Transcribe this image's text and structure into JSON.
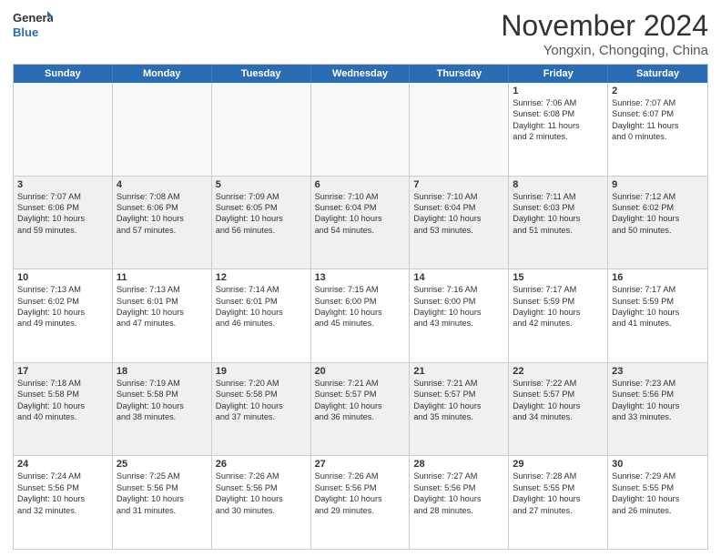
{
  "logo": {
    "general": "General",
    "blue": "Blue"
  },
  "title": "November 2024",
  "subtitle": "Yongxin, Chongqing, China",
  "headers": [
    "Sunday",
    "Monday",
    "Tuesday",
    "Wednesday",
    "Thursday",
    "Friday",
    "Saturday"
  ],
  "rows": [
    [
      {
        "day": "",
        "text": "",
        "empty": true
      },
      {
        "day": "",
        "text": "",
        "empty": true
      },
      {
        "day": "",
        "text": "",
        "empty": true
      },
      {
        "day": "",
        "text": "",
        "empty": true
      },
      {
        "day": "",
        "text": "",
        "empty": true
      },
      {
        "day": "1",
        "text": "Sunrise: 7:06 AM\nSunset: 6:08 PM\nDaylight: 11 hours\nand 2 minutes.",
        "empty": false
      },
      {
        "day": "2",
        "text": "Sunrise: 7:07 AM\nSunset: 6:07 PM\nDaylight: 11 hours\nand 0 minutes.",
        "empty": false
      }
    ],
    [
      {
        "day": "3",
        "text": "Sunrise: 7:07 AM\nSunset: 6:06 PM\nDaylight: 10 hours\nand 59 minutes.",
        "empty": false
      },
      {
        "day": "4",
        "text": "Sunrise: 7:08 AM\nSunset: 6:06 PM\nDaylight: 10 hours\nand 57 minutes.",
        "empty": false
      },
      {
        "day": "5",
        "text": "Sunrise: 7:09 AM\nSunset: 6:05 PM\nDaylight: 10 hours\nand 56 minutes.",
        "empty": false
      },
      {
        "day": "6",
        "text": "Sunrise: 7:10 AM\nSunset: 6:04 PM\nDaylight: 10 hours\nand 54 minutes.",
        "empty": false
      },
      {
        "day": "7",
        "text": "Sunrise: 7:10 AM\nSunset: 6:04 PM\nDaylight: 10 hours\nand 53 minutes.",
        "empty": false
      },
      {
        "day": "8",
        "text": "Sunrise: 7:11 AM\nSunset: 6:03 PM\nDaylight: 10 hours\nand 51 minutes.",
        "empty": false
      },
      {
        "day": "9",
        "text": "Sunrise: 7:12 AM\nSunset: 6:02 PM\nDaylight: 10 hours\nand 50 minutes.",
        "empty": false
      }
    ],
    [
      {
        "day": "10",
        "text": "Sunrise: 7:13 AM\nSunset: 6:02 PM\nDaylight: 10 hours\nand 49 minutes.",
        "empty": false
      },
      {
        "day": "11",
        "text": "Sunrise: 7:13 AM\nSunset: 6:01 PM\nDaylight: 10 hours\nand 47 minutes.",
        "empty": false
      },
      {
        "day": "12",
        "text": "Sunrise: 7:14 AM\nSunset: 6:01 PM\nDaylight: 10 hours\nand 46 minutes.",
        "empty": false
      },
      {
        "day": "13",
        "text": "Sunrise: 7:15 AM\nSunset: 6:00 PM\nDaylight: 10 hours\nand 45 minutes.",
        "empty": false
      },
      {
        "day": "14",
        "text": "Sunrise: 7:16 AM\nSunset: 6:00 PM\nDaylight: 10 hours\nand 43 minutes.",
        "empty": false
      },
      {
        "day": "15",
        "text": "Sunrise: 7:17 AM\nSunset: 5:59 PM\nDaylight: 10 hours\nand 42 minutes.",
        "empty": false
      },
      {
        "day": "16",
        "text": "Sunrise: 7:17 AM\nSunset: 5:59 PM\nDaylight: 10 hours\nand 41 minutes.",
        "empty": false
      }
    ],
    [
      {
        "day": "17",
        "text": "Sunrise: 7:18 AM\nSunset: 5:58 PM\nDaylight: 10 hours\nand 40 minutes.",
        "empty": false
      },
      {
        "day": "18",
        "text": "Sunrise: 7:19 AM\nSunset: 5:58 PM\nDaylight: 10 hours\nand 38 minutes.",
        "empty": false
      },
      {
        "day": "19",
        "text": "Sunrise: 7:20 AM\nSunset: 5:58 PM\nDaylight: 10 hours\nand 37 minutes.",
        "empty": false
      },
      {
        "day": "20",
        "text": "Sunrise: 7:21 AM\nSunset: 5:57 PM\nDaylight: 10 hours\nand 36 minutes.",
        "empty": false
      },
      {
        "day": "21",
        "text": "Sunrise: 7:21 AM\nSunset: 5:57 PM\nDaylight: 10 hours\nand 35 minutes.",
        "empty": false
      },
      {
        "day": "22",
        "text": "Sunrise: 7:22 AM\nSunset: 5:57 PM\nDaylight: 10 hours\nand 34 minutes.",
        "empty": false
      },
      {
        "day": "23",
        "text": "Sunrise: 7:23 AM\nSunset: 5:56 PM\nDaylight: 10 hours\nand 33 minutes.",
        "empty": false
      }
    ],
    [
      {
        "day": "24",
        "text": "Sunrise: 7:24 AM\nSunset: 5:56 PM\nDaylight: 10 hours\nand 32 minutes.",
        "empty": false
      },
      {
        "day": "25",
        "text": "Sunrise: 7:25 AM\nSunset: 5:56 PM\nDaylight: 10 hours\nand 31 minutes.",
        "empty": false
      },
      {
        "day": "26",
        "text": "Sunrise: 7:26 AM\nSunset: 5:56 PM\nDaylight: 10 hours\nand 30 minutes.",
        "empty": false
      },
      {
        "day": "27",
        "text": "Sunrise: 7:26 AM\nSunset: 5:56 PM\nDaylight: 10 hours\nand 29 minutes.",
        "empty": false
      },
      {
        "day": "28",
        "text": "Sunrise: 7:27 AM\nSunset: 5:56 PM\nDaylight: 10 hours\nand 28 minutes.",
        "empty": false
      },
      {
        "day": "29",
        "text": "Sunrise: 7:28 AM\nSunset: 5:55 PM\nDaylight: 10 hours\nand 27 minutes.",
        "empty": false
      },
      {
        "day": "30",
        "text": "Sunrise: 7:29 AM\nSunset: 5:55 PM\nDaylight: 10 hours\nand 26 minutes.",
        "empty": false
      }
    ]
  ]
}
